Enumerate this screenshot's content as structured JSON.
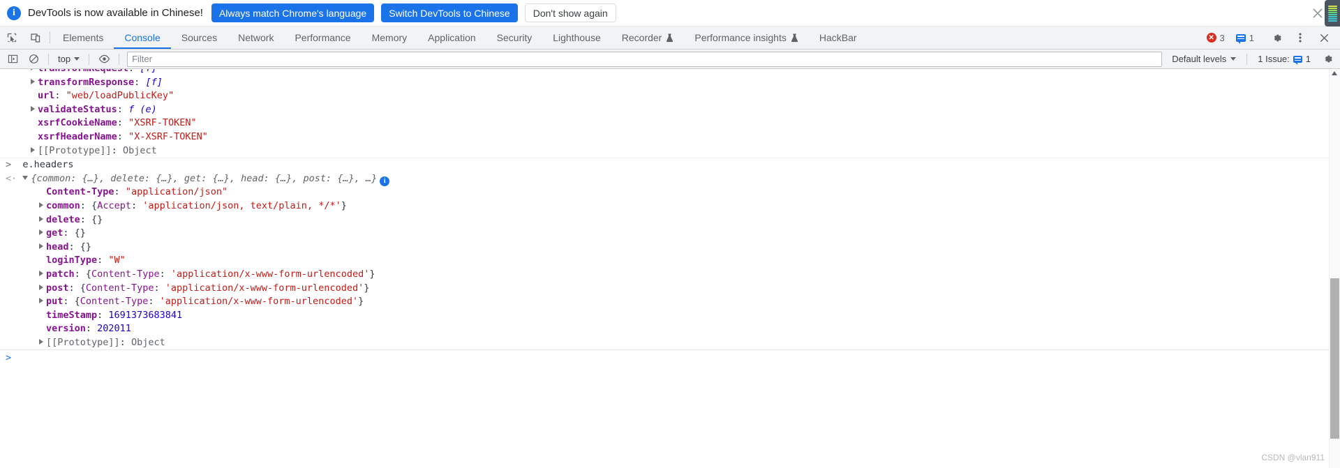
{
  "banner": {
    "info_icon": "info-icon",
    "message": "DevTools is now available in Chinese!",
    "primary_button_1": "Always match Chrome's language",
    "primary_button_2": "Switch DevTools to Chinese",
    "dismiss_button": "Don't show again",
    "close_icon": "close-icon",
    "accent_color": "#1a73e8"
  },
  "tabbar": {
    "inspect_icon": "inspect-element-icon",
    "device_icon": "device-toolbar-icon",
    "tabs": [
      {
        "label": "Elements",
        "active": false,
        "experimental": false
      },
      {
        "label": "Console",
        "active": true,
        "experimental": false
      },
      {
        "label": "Sources",
        "active": false,
        "experimental": false
      },
      {
        "label": "Network",
        "active": false,
        "experimental": false
      },
      {
        "label": "Performance",
        "active": false,
        "experimental": false
      },
      {
        "label": "Memory",
        "active": false,
        "experimental": false
      },
      {
        "label": "Application",
        "active": false,
        "experimental": false
      },
      {
        "label": "Security",
        "active": false,
        "experimental": false
      },
      {
        "label": "Lighthouse",
        "active": false,
        "experimental": false
      },
      {
        "label": "Recorder",
        "active": false,
        "experimental": true
      },
      {
        "label": "Performance insights",
        "active": false,
        "experimental": true
      },
      {
        "label": "HackBar",
        "active": false,
        "experimental": false
      }
    ],
    "error_count": "3",
    "message_count": "1",
    "settings_icon": "gear-icon",
    "more_icon": "kebab-menu-icon",
    "close_icon": "close-devtools-icon",
    "active_color": "#1a73e8",
    "error_color": "#d93025"
  },
  "filterbar": {
    "sidebar_toggle_icon": "console-sidebar-icon",
    "clear_icon": "clear-console-icon",
    "context_value": "top",
    "eye_icon": "live-expression-icon",
    "filter_placeholder": "Filter",
    "filter_value": "",
    "levels_label": "Default levels",
    "issues_label": "1 Issue:",
    "issues_count": "1",
    "settings_icon": "console-settings-icon"
  },
  "console": {
    "lines": [
      {
        "indent": 3,
        "tri": "closed",
        "prop": "transformRequest",
        "sep": ": ",
        "val": "[f]",
        "valclass": "fn",
        "clipped": true
      },
      {
        "indent": 3,
        "tri": "closed",
        "prop": "transformResponse",
        "sep": ": ",
        "val": "[f]",
        "valclass": "fn"
      },
      {
        "indent": 3,
        "tri": "none",
        "prop": "url",
        "sep": ": ",
        "val": "\"web/loadPublicKey\"",
        "valclass": "str"
      },
      {
        "indent": 3,
        "tri": "closed",
        "prop": "validateStatus",
        "sep": ": ",
        "val": "f (e)",
        "valclass": "fn"
      },
      {
        "indent": 3,
        "tri": "none",
        "prop": "xsrfCookieName",
        "sep": ": ",
        "val": "\"XSRF-TOKEN\"",
        "valclass": "str"
      },
      {
        "indent": 3,
        "tri": "none",
        "prop": "xsrfHeaderName",
        "sep": ": ",
        "val": "\"X-XSRF-TOKEN\"",
        "valclass": "str"
      },
      {
        "indent": 3,
        "tri": "closed",
        "prop": "[[Prototype]]",
        "sep": ": ",
        "val": "Object",
        "valclass": "proto",
        "protokey": true
      }
    ],
    "command": "e.headers",
    "command_prompt": ">",
    "result_prompt": "<",
    "result_preview": "{common: {…}, delete: {…}, get: {…}, head: {…}, post: {…}, …}",
    "result_info_icon": "info-badge",
    "result_lines": [
      {
        "indent": 4,
        "tri": "none",
        "prop": "Content-Type",
        "sep": ": ",
        "val": "\"application/json\"",
        "valclass": "str"
      },
      {
        "indent": 4,
        "tri": "closed",
        "prop": "common",
        "sep": ": ",
        "val": "{Accept: 'application/json, text/plain, */*'}",
        "valclass": "objpreview"
      },
      {
        "indent": 4,
        "tri": "closed",
        "prop": "delete",
        "sep": ": ",
        "val": "{}",
        "valclass": "plain"
      },
      {
        "indent": 4,
        "tri": "closed",
        "prop": "get",
        "sep": ": ",
        "val": "{}",
        "valclass": "plain"
      },
      {
        "indent": 4,
        "tri": "closed",
        "prop": "head",
        "sep": ": ",
        "val": "{}",
        "valclass": "plain"
      },
      {
        "indent": 4,
        "tri": "none",
        "prop": "loginType",
        "sep": ": ",
        "val": "\"W\"",
        "valclass": "str"
      },
      {
        "indent": 4,
        "tri": "closed",
        "prop": "patch",
        "sep": ": ",
        "val": "{Content-Type: 'application/x-www-form-urlencoded'}",
        "valclass": "objpreview"
      },
      {
        "indent": 4,
        "tri": "closed",
        "prop": "post",
        "sep": ": ",
        "val": "{Content-Type: 'application/x-www-form-urlencoded'}",
        "valclass": "objpreview"
      },
      {
        "indent": 4,
        "tri": "closed",
        "prop": "put",
        "sep": ": ",
        "val": "{Content-Type: 'application/x-www-form-urlencoded'}",
        "valclass": "objpreview"
      },
      {
        "indent": 4,
        "tri": "none",
        "prop": "timeStamp",
        "sep": ": ",
        "val": "1691373683841",
        "valclass": "num"
      },
      {
        "indent": 4,
        "tri": "none",
        "prop": "version",
        "sep": ": ",
        "val": "202011",
        "valclass": "num"
      },
      {
        "indent": 4,
        "tri": "closed",
        "prop": "[[Prototype]]",
        "sep": ": ",
        "val": "Object",
        "valclass": "proto",
        "protokey": true
      }
    ],
    "input_prompt": ">",
    "watermark": "CSDN @vlan911"
  }
}
